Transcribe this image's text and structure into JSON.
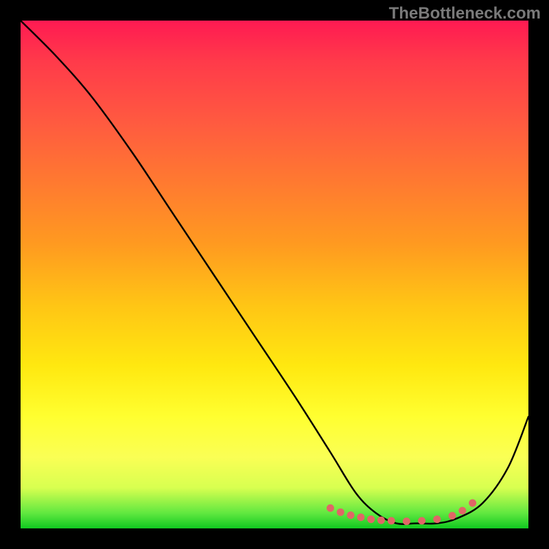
{
  "watermark": "TheBottleneck.com",
  "chart_data": {
    "type": "line",
    "title": "",
    "xlabel": "",
    "ylabel": "",
    "xlim": [
      0,
      100
    ],
    "ylim": [
      0,
      100
    ],
    "series": [
      {
        "name": "curve",
        "x": [
          0,
          7,
          14,
          22,
          30,
          38,
          46,
          54,
          61,
          66,
          70,
          74,
          78,
          82,
          86,
          91,
          96,
          100
        ],
        "values": [
          100,
          93,
          85,
          74,
          62,
          50,
          38,
          26,
          15,
          7,
          3,
          1,
          1,
          1,
          2,
          5,
          12,
          22
        ]
      }
    ],
    "markers": {
      "name": "dots",
      "color": "#e06666",
      "x": [
        61,
        63,
        65,
        67,
        69,
        71,
        73,
        76,
        79,
        82,
        85,
        87,
        89
      ],
      "values": [
        4,
        3.2,
        2.6,
        2.2,
        1.8,
        1.6,
        1.5,
        1.4,
        1.5,
        1.8,
        2.5,
        3.5,
        5
      ]
    }
  }
}
